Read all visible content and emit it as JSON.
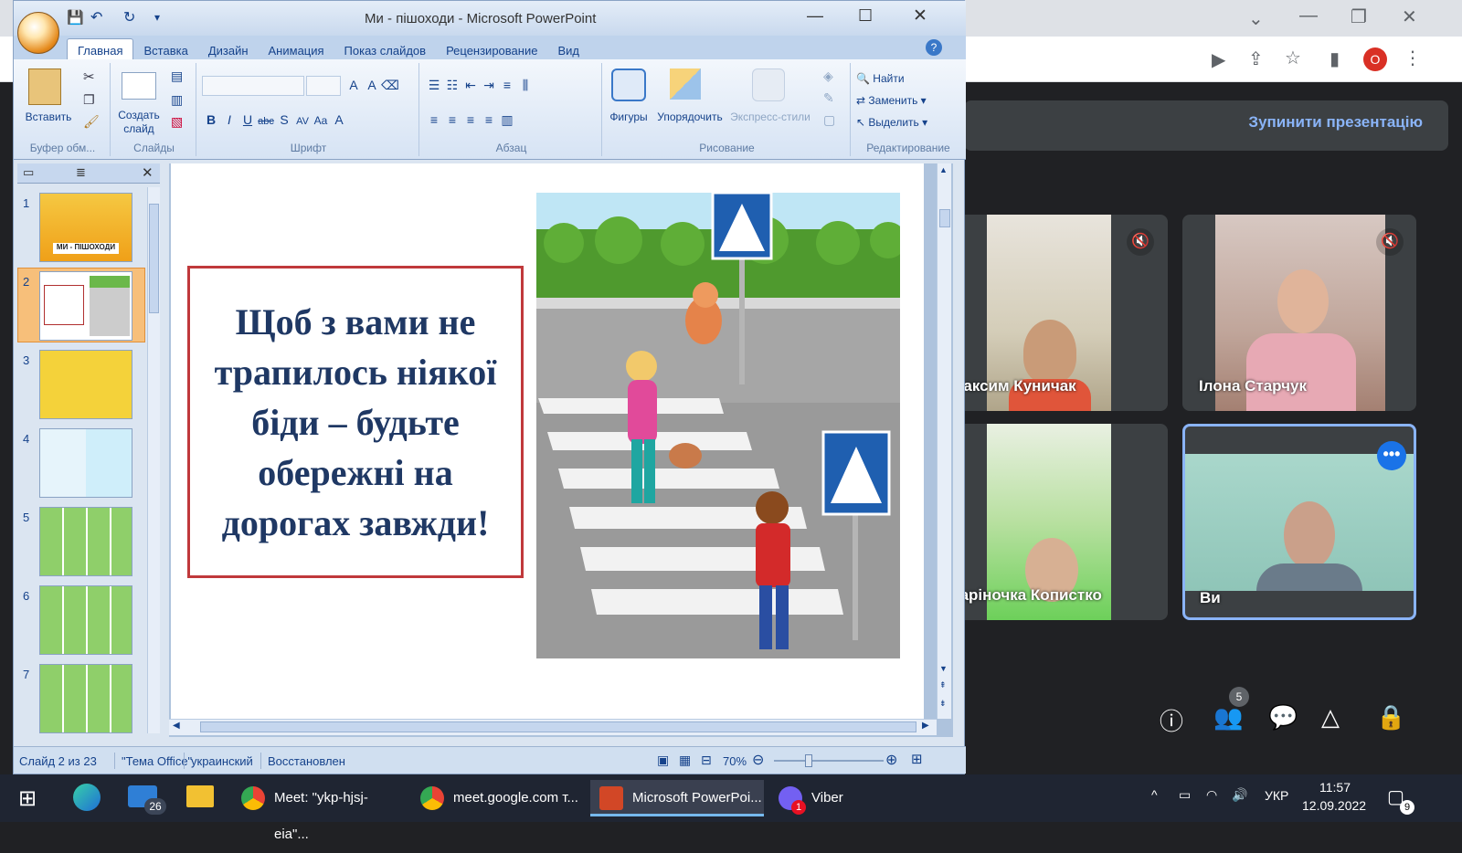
{
  "ppt": {
    "title": "Ми - пішоходи - Microsoft PowerPoint",
    "tabs": [
      "Главная",
      "Вставка",
      "Дизайн",
      "Анимация",
      "Показ слайдов",
      "Рецензирование",
      "Вид"
    ],
    "ribbon": {
      "paste": "Вставить",
      "create_slide": "Создать слайд",
      "shapes": "Фигуры",
      "arrange": "Упорядочить",
      "express_styles": "Экспресс-стили",
      "find": "Найти",
      "replace": "Заменить",
      "select": "Выделить",
      "groups": {
        "clipboard": "Буфер обм...",
        "slides": "Слайды",
        "font": "Шрифт",
        "paragraph": "Абзац",
        "drawing": "Рисование",
        "editing": "Редактирование"
      }
    },
    "thumbs": [
      "1",
      "2",
      "3",
      "4",
      "5",
      "6",
      "7"
    ],
    "thumb1_caption": "МИ - ПІШОХОДИ",
    "slide": {
      "text": "Щоб з вами не трапилось ніякої біди – будьте обережні на дорогах завжди!"
    },
    "status": {
      "slide": "Слайд 2 из 23",
      "theme": "\"Тема Office\"",
      "lang": "украинский",
      "restored": "Восстановлен",
      "zoom": "70%"
    }
  },
  "meet": {
    "stop_presenting": "Зупинити презентацію",
    "participants": [
      {
        "name": "Максим Куничак"
      },
      {
        "name": "Ілона Старчук"
      },
      {
        "name": "Каріночка Копистко"
      },
      {
        "name": "Ви"
      }
    ],
    "people_count": "5"
  },
  "chrome": {
    "profile_letter": "O"
  },
  "taskbar": {
    "mail_badge": "26",
    "items": [
      "Meet: \"ykp-hjsj-eia\"...",
      "meet.google.com т...",
      "Microsoft PowerPoi...",
      "Viber"
    ],
    "viber_badge": "1",
    "lang": "УКР",
    "time": "11:57",
    "date": "12.09.2022",
    "notif": "9"
  }
}
